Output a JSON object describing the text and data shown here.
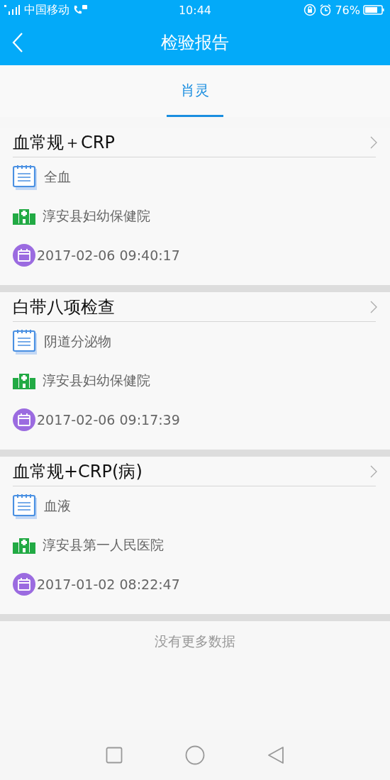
{
  "status_bar": {
    "carrier": "中国移动",
    "time": "10:44",
    "battery": "76%"
  },
  "header": {
    "title": "检验报告"
  },
  "tabs": [
    {
      "label": "肖灵",
      "selected": true
    }
  ],
  "reports": [
    {
      "title": "血常规＋CRP",
      "specimen": "全血",
      "hospital": "淳安县妇幼保健院",
      "datetime": "2017-02-06 09:40:17"
    },
    {
      "title": "白带八项检查",
      "specimen": "阴道分泌物",
      "hospital": "淳安县妇幼保健院",
      "datetime": "2017-02-06 09:17:39"
    },
    {
      "title": "血常规+CRP(病)",
      "specimen": "血液",
      "hospital": "淳安县第一人民医院",
      "datetime": "2017-01-02 08:22:47"
    }
  ],
  "footer_note": "没有更多数据"
}
